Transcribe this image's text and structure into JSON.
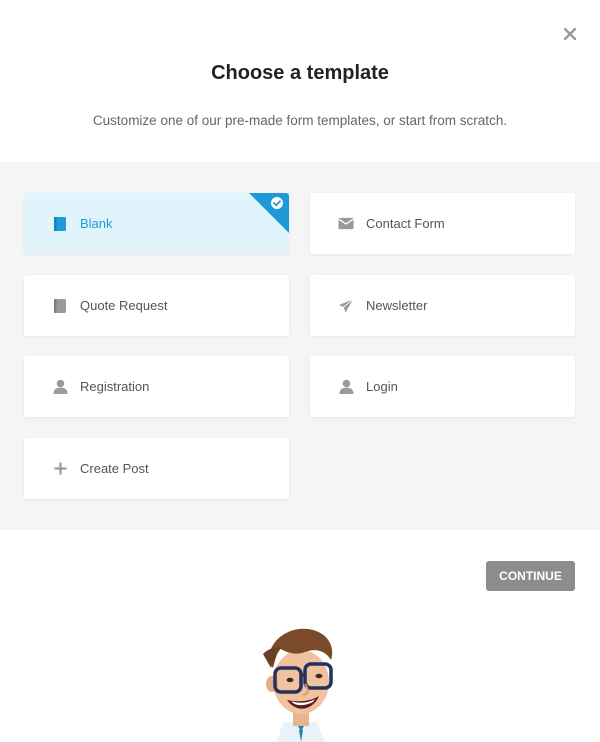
{
  "dialog": {
    "title": "Choose a template",
    "subtitle": "Customize one of our pre-made form templates, or start from scratch.",
    "close_icon": "close-icon"
  },
  "templates": [
    {
      "label": "Blank",
      "icon": "blank-page-icon",
      "selected": true
    },
    {
      "label": "Contact Form",
      "icon": "envelope-icon",
      "selected": false
    },
    {
      "label": "Quote Request",
      "icon": "document-icon",
      "selected": false
    },
    {
      "label": "Newsletter",
      "icon": "paper-plane-icon",
      "selected": false
    },
    {
      "label": "Registration",
      "icon": "user-icon",
      "selected": false
    },
    {
      "label": "Login",
      "icon": "user-icon",
      "selected": false
    },
    {
      "label": "Create Post",
      "icon": "plus-icon",
      "selected": false
    }
  ],
  "footer": {
    "continue_label": "CONTINUE"
  },
  "colors": {
    "accent": "#1e9bd6",
    "selected_bg": "#e1f4fc",
    "button_bg": "#8c8c8c",
    "grid_bg": "#f5f5f5"
  }
}
